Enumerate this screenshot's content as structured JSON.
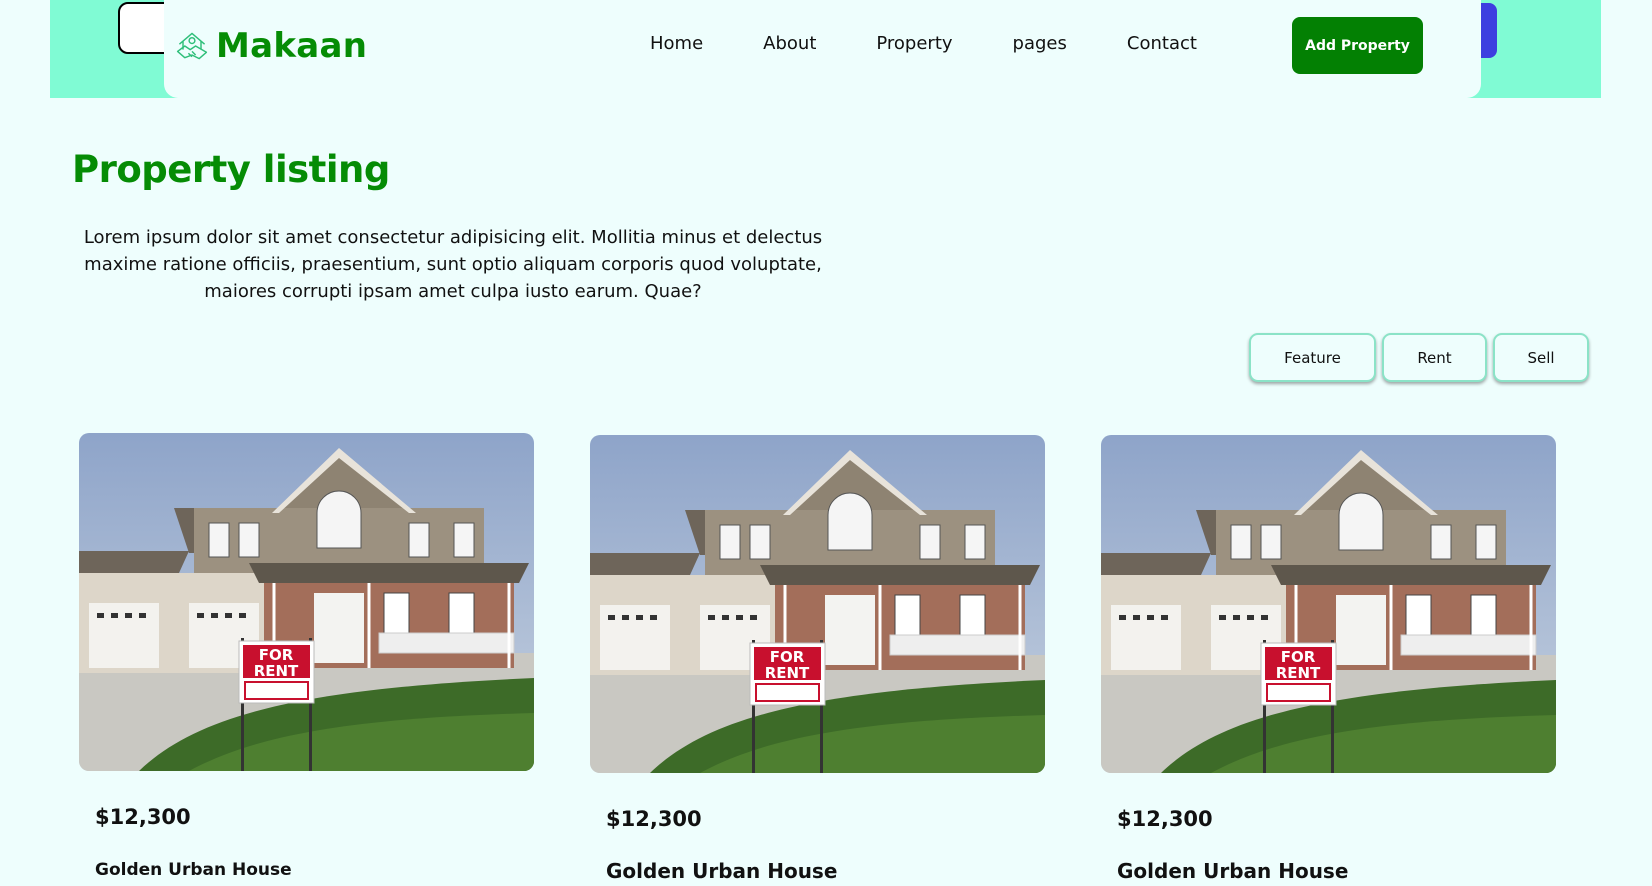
{
  "brand": {
    "name": "Makaan",
    "logo_icon": "handshake-house-icon",
    "color": "#058c05"
  },
  "nav": {
    "links": [
      "Home",
      "About",
      "Property",
      "pages",
      "Contact"
    ],
    "add_button": "Add Property"
  },
  "hero": {
    "title": "Property listing",
    "description": "Lorem ipsum dolor sit amet consectetur adipisicing elit. Mollitia minus et delectus maxime ratione officiis, praesentium, sunt optio aliquam corporis quod voluptate, maiores corrupti ipsam amet culpa iusto earum. Quae?"
  },
  "filters": [
    "Feature",
    "Rent",
    "Sell"
  ],
  "listings": [
    {
      "price": "$12,300",
      "name": "Golden Urban House",
      "sign_line1": "FOR",
      "sign_line2": "RENT"
    },
    {
      "price": "$12,300",
      "name": "Golden Urban House",
      "sign_line1": "FOR",
      "sign_line2": "RENT"
    },
    {
      "price": "$12,300",
      "name": "Golden Urban House",
      "sign_line1": "FOR",
      "sign_line2": "RENT"
    }
  ],
  "colors": {
    "page_bg": "#eefefd",
    "top_band": "#80fbd4",
    "primary_green": "#058c05",
    "filter_border": "#8be3c7"
  }
}
